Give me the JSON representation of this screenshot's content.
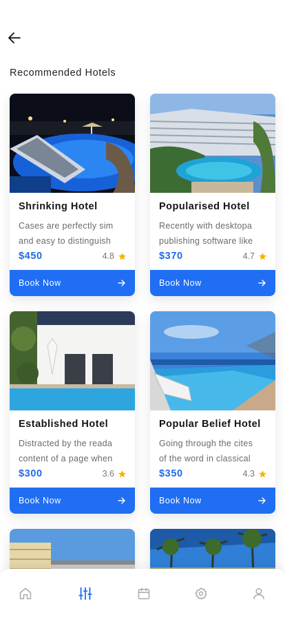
{
  "header": {
    "back_icon": "arrow-left-icon",
    "section_title": "Recommended Hotels"
  },
  "colors": {
    "accent": "#1f6ef3",
    "price": "#1f6be8",
    "star": "#f5b400",
    "nav_active": "#1f6ef3",
    "nav_inactive": "#a9a9a9"
  },
  "hotels": [
    {
      "name": "Shrinking Hotel",
      "desc_line1": "Cases are perfectly sim",
      "desc_line2": "and easy to distinguish",
      "price": "$450",
      "rating": "4.8",
      "book_label": "Book Now"
    },
    {
      "name": "Popularised Hotel",
      "desc_line1": "Recently with desktopa",
      "desc_line2": "publishing software like",
      "price": "$370",
      "rating": "4.7",
      "book_label": "Book Now"
    },
    {
      "name": "Established Hotel",
      "desc_line1": "Distracted by the reada",
      "desc_line2": "content of a page when",
      "price": "$300",
      "rating": "3.6",
      "book_label": "Book Now"
    },
    {
      "name": "Popular Belief Hotel",
      "desc_line1": "Going through the cites",
      "desc_line2": "of the word in classical",
      "price": "$350",
      "rating": "4.3",
      "book_label": "Book Now"
    }
  ],
  "navbar": {
    "items": [
      {
        "icon": "home-icon",
        "active": false
      },
      {
        "icon": "filter-sliders-icon",
        "active": true
      },
      {
        "icon": "calendar-icon",
        "active": false
      },
      {
        "icon": "settings-gear-icon",
        "active": false
      },
      {
        "icon": "user-profile-icon",
        "active": false
      }
    ]
  }
}
